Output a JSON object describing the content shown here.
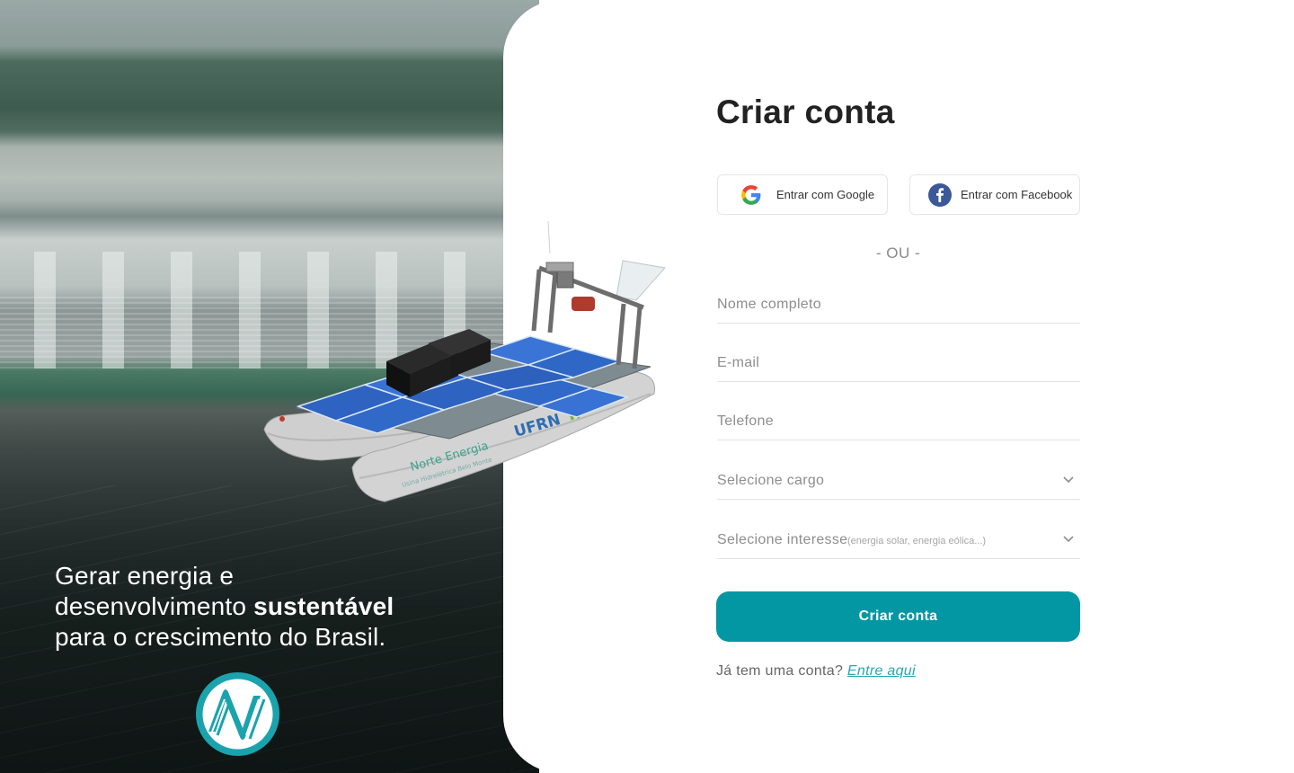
{
  "hero": {
    "tagline_line1": "Gerar energia e",
    "tagline_line2_prefix": "desenvolvimento ",
    "tagline_line2_bold": "sustentável",
    "tagline_line3": "para o crescimento do Brasil.",
    "logo_icon": "brand-n-logo-icon"
  },
  "form": {
    "title": "Criar conta",
    "google_label": "Entrar com Google",
    "facebook_label": "Entrar com Facebook",
    "or_separator": "- OU -",
    "name_placeholder": "Nome completo",
    "email_placeholder": "E-mail",
    "phone_placeholder": "Telefone",
    "cargo_placeholder": "Selecione cargo",
    "interest_placeholder": "Selecione interesse",
    "interest_hint": "(energia solar, energia eólica...)",
    "submit_label": "Criar conta",
    "login_prompt": "Já tem uma conta?",
    "login_link": "Entre aqui"
  },
  "boat": {
    "brand_text": "Norte Energia",
    "brand_subtext": "Usina Hidrelétrica Belo Monte",
    "partner_text": "UFRN",
    "partner_text_2": "IF"
  },
  "colors": {
    "accent": "#0297a3",
    "link": "#2aa7b1",
    "title": "#222222",
    "placeholder": "#8e8e8e",
    "facebook": "#3b5998"
  }
}
